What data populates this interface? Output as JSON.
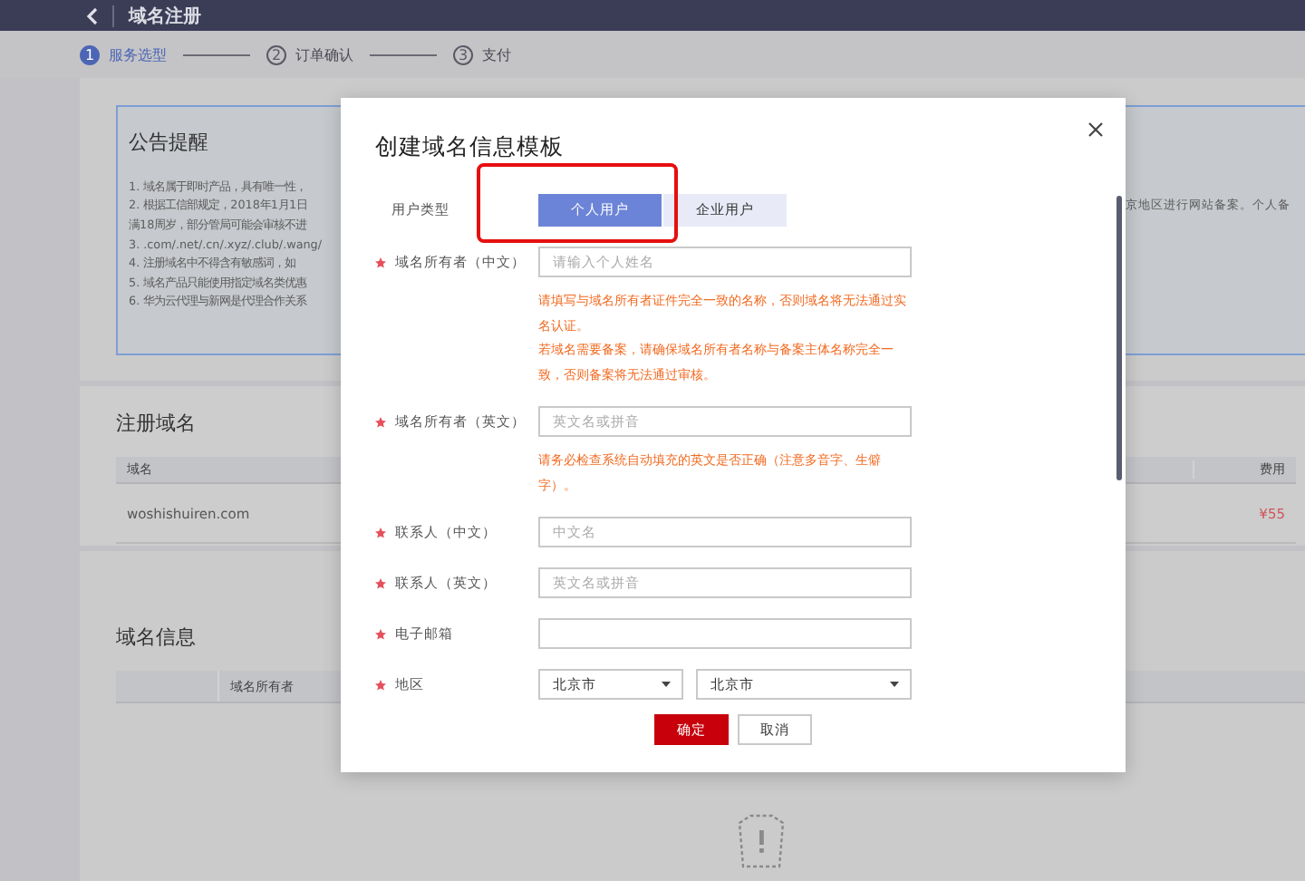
{
  "top_bar": {
    "title": "域名注册"
  },
  "steps": [
    {
      "number": "1",
      "label": "服务选型",
      "selected": true
    },
    {
      "number": "2",
      "label": "订单确认",
      "selected": false
    },
    {
      "number": "3",
      "label": "支付",
      "selected": false
    }
  ],
  "notice": {
    "title": "公告提醒",
    "lines": [
      {
        "left": "1. 域名属于即时产品，具有唯一性，"
      },
      {
        "left": "2. 根据工信部规定，2018年1月1日",
        "right": "京地区进行网站备案。个人备"
      },
      {
        "left": "满18周岁，部分管局可能会审核不进"
      },
      {
        "left": "3. .com/.net/.cn/.xyz/.club/.wang/"
      },
      {
        "left": "4. 注册域名中不得含有敏感词，如"
      },
      {
        "left": "5. 域名产品只能使用指定域名类优惠"
      },
      {
        "left": "6. 华为云代理与新网是代理合作关系"
      }
    ]
  },
  "register_section": {
    "title": "注册域名",
    "columns": [
      "域名",
      "费用"
    ],
    "rows": [
      [
        "woshishuiren.com",
        "¥55"
      ]
    ]
  },
  "info_section": {
    "title": "域名信息",
    "columns": [
      "域名所有者"
    ]
  },
  "dialog": {
    "title": "创建域名信息模板",
    "user_type": {
      "label": "用户类型",
      "highlighted": true,
      "options": [
        {
          "label": "个人用户",
          "selected": true
        },
        {
          "label": "企业用户",
          "selected": false
        }
      ]
    },
    "fields": [
      {
        "kind": "input",
        "label": "域名所有者（中文）",
        "required": true,
        "placeholder": "请输入个人姓名",
        "hints": [
          "请填写与域名所有者证件完全一致的名称，否则域名将无法通过实名认证。",
          "若域名需要备案，请确保域名所有者名称与备案主体名称完全一致，否则备案将无法通过审核。"
        ]
      },
      {
        "kind": "input",
        "label": "域名所有者（英文）",
        "required": true,
        "placeholder": "英文名或拼音",
        "hints": [
          "请务必检查系统自动填充的英文是否正确（注意多音字、生僻字）。"
        ]
      },
      {
        "kind": "input",
        "label": "联系人（中文）",
        "required": true,
        "placeholder": "中文名"
      },
      {
        "kind": "input",
        "label": "联系人（英文）",
        "required": true,
        "placeholder": "英文名或拼音"
      },
      {
        "kind": "input",
        "label": "电子邮箱",
        "required": true
      },
      {
        "kind": "select-pair",
        "label": "地区",
        "required": true,
        "values": [
          "北京市",
          "北京市"
        ]
      }
    ],
    "buttons": [
      {
        "label": "确定",
        "kind": "primary"
      },
      {
        "label": "取消",
        "kind": "secondary"
      }
    ]
  }
}
